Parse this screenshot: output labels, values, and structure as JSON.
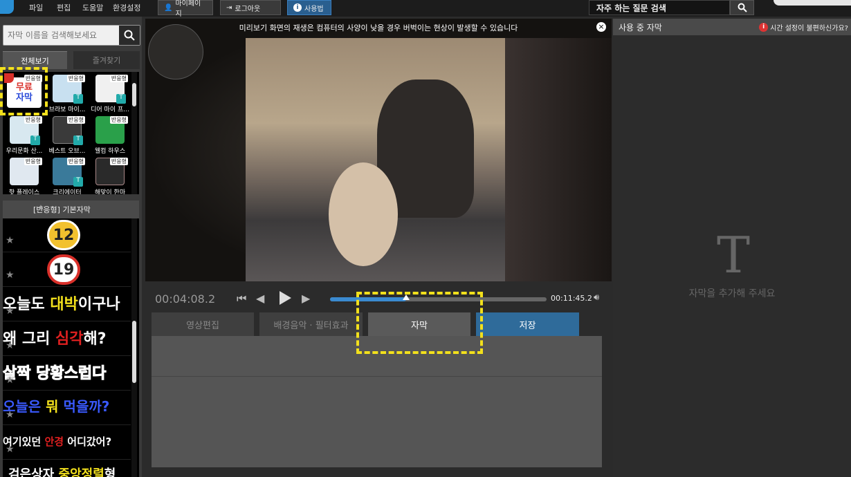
{
  "menu": {
    "items": [
      "파일",
      "편집",
      "도움말",
      "환경설정"
    ],
    "mypage": "마이페이지",
    "logout": "로그아웃",
    "howto": "사용법"
  },
  "faq": {
    "placeholder": "자주 하는 질문 검색"
  },
  "left": {
    "search_placeholder": "자막 이름을 검색해보세요",
    "tabs": [
      "전체보기",
      "즐겨찾기"
    ],
    "thumb_badge": "반응형",
    "thumbs": [
      {
        "caption": "무료 자막",
        "color": "#ffffff"
      },
      {
        "caption": "브라보 마이...",
        "color": "#c8e0f0"
      },
      {
        "caption": "디어 마이 프...",
        "color": "#f0f0f0"
      },
      {
        "caption": "우리문화 산...",
        "color": "#d8e8f0"
      },
      {
        "caption": "베스트 오브...",
        "color": "#3a3a3a"
      },
      {
        "caption": "웰컴 하우스",
        "color": "#2aa04a"
      },
      {
        "caption": "핫 플레이스",
        "color": "#e0e8f0"
      },
      {
        "caption": "크리에이터",
        "color": "#3a7a9a"
      },
      {
        "caption": "해맞이 한마",
        "color": "#2a2a2a"
      }
    ],
    "free_label_top": "무료",
    "free_label_bottom": "자막",
    "section_title": "[반응형] 기본자막",
    "styles": [
      {
        "text": "12",
        "color": "#222"
      },
      {
        "text": "19",
        "color": "#222"
      },
      {
        "text": "오늘도 대박이구나",
        "color": "#ffffff"
      },
      {
        "text": "왜 그리 심각해?",
        "color": "#ffffff"
      },
      {
        "text": "살짝 당황스럽다",
        "color": "#ffffff"
      },
      {
        "text": "오늘은 뭐 먹을까?",
        "color": "#3a5aff"
      },
      {
        "text": "여기있던 안경 어디갔어?",
        "color": "#ffffff"
      },
      {
        "text": "검은상자 중앙정렬형",
        "color": "#ffffff"
      }
    ]
  },
  "video": {
    "notice": "미리보기 화면의 재생은 컴퓨터의 사양이 낮을 경우 버벅이는 현상이 발생할 수 있습니다",
    "current_time": "00:04:08.2",
    "end_time": "00:11:45.2",
    "progress": 0.35
  },
  "editor": {
    "tabs": [
      "영상편집",
      "배경음악 · 필터효과",
      "자막",
      "저장"
    ]
  },
  "right": {
    "title": "사용 중 자막",
    "help": "시간 설정이 불편하신가요?",
    "empty": "자막을 추가해 주세요"
  }
}
